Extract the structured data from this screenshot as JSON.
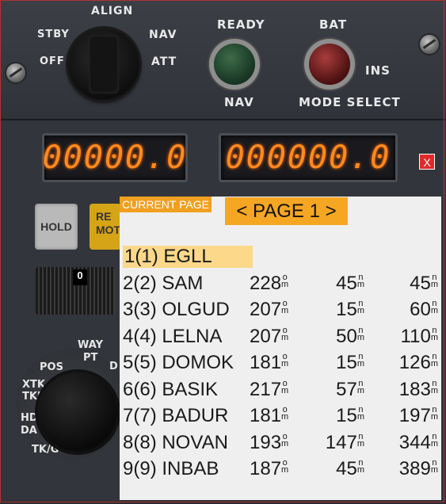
{
  "panel": {
    "mode_selector": {
      "labels": {
        "align": "ALIGN",
        "stby": "STBY",
        "off": "OFF",
        "nav": "NAV",
        "att": "ATT"
      }
    },
    "ready_light": {
      "top_label": "READY",
      "bottom_label": "NAV"
    },
    "bat_light": {
      "top_label": "BAT"
    },
    "ins_label": "INS",
    "mode_select_label": "MODE SELECT",
    "display_left": "00000.0",
    "display_right": "000000.0",
    "hold_button": "HOLD",
    "remote_button": "RE\nMOT",
    "thumbwheel_value": "0",
    "waypoint_knob": {
      "labels": {
        "way": "WAY",
        "pt": "PT",
        "pos": "POS",
        "xtk": "XTK",
        "tke": "TKE",
        "hd": "HD",
        "da": "DA",
        "tk": "TK/G",
        "d": "D"
      }
    }
  },
  "close_button": "X",
  "overlay": {
    "current_page_label": "CURRENT PAGE",
    "page_button": "< PAGE 1 >",
    "units": {
      "deg_top": "o",
      "deg_bottom": "m",
      "nm_top": "n",
      "nm_bottom": "m"
    },
    "waypoints": [
      {
        "name": "1(1) EGLL",
        "heading": "",
        "distance": "",
        "cumulative": ""
      },
      {
        "name": "2(2) SAM",
        "heading": "228",
        "distance": "45",
        "cumulative": "45"
      },
      {
        "name": "3(3) OLGUD",
        "heading": "207",
        "distance": "15",
        "cumulative": "60"
      },
      {
        "name": "4(4) LELNA",
        "heading": "207",
        "distance": "50",
        "cumulative": "110"
      },
      {
        "name": "5(5) DOMOK",
        "heading": "181",
        "distance": "15",
        "cumulative": "126"
      },
      {
        "name": "6(6) BASIK",
        "heading": "217",
        "distance": "57",
        "cumulative": "183"
      },
      {
        "name": "7(7) BADUR",
        "heading": "181",
        "distance": "15",
        "cumulative": "197"
      },
      {
        "name": "8(8) NOVAN",
        "heading": "193",
        "distance": "147",
        "cumulative": "344"
      },
      {
        "name": "9(9) INBAB",
        "heading": "187",
        "distance": "45",
        "cumulative": "389"
      }
    ]
  }
}
